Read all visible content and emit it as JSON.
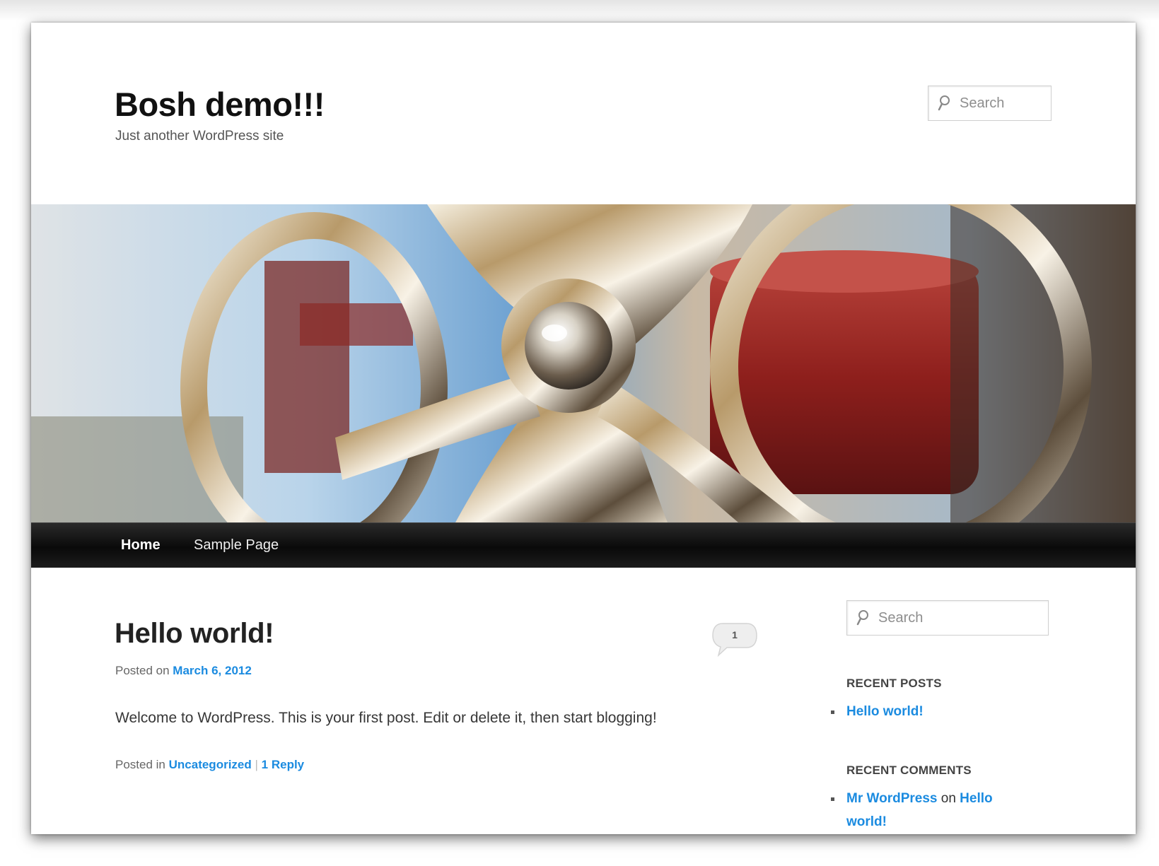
{
  "site": {
    "title": "Bosh demo!!!",
    "description": "Just another WordPress site"
  },
  "search": {
    "placeholder": "Search"
  },
  "nav": {
    "items": [
      {
        "label": "Home",
        "active": true
      },
      {
        "label": "Sample Page",
        "active": false
      }
    ]
  },
  "post": {
    "title": "Hello world!",
    "comment_count": "1",
    "posted_on_label": "Posted on",
    "date": "March 6, 2012",
    "body": "Welcome to WordPress. This is your first post. Edit or delete it, then start blogging!",
    "posted_in_label": "Posted in",
    "category": "Uncategorized",
    "separator": "|",
    "reply_link": "1 Reply"
  },
  "sidebar": {
    "search_placeholder": "Search",
    "recent_posts": {
      "title": "RECENT POSTS",
      "items": [
        "Hello world!"
      ]
    },
    "recent_comments": {
      "title": "RECENT COMMENTS",
      "author": "Mr WordPress",
      "on_word": "on",
      "post": "Hello world!"
    }
  },
  "colors": {
    "link": "#1b8be0",
    "nav_bg": "#111111",
    "title": "#111111"
  }
}
